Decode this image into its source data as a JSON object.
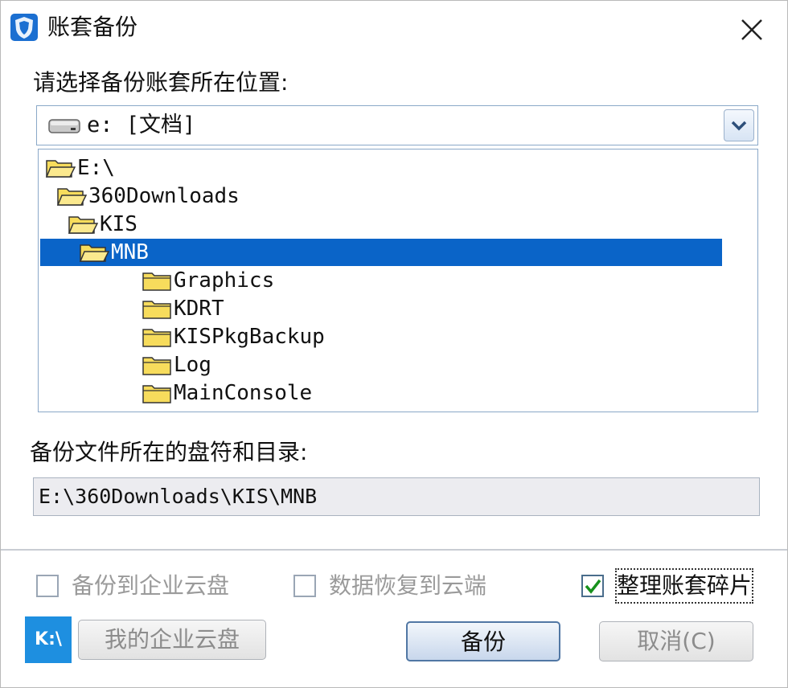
{
  "window": {
    "title": "账套备份"
  },
  "location_label": "请选择备份账套所在位置:",
  "drive_select": {
    "value": "e: [文档]"
  },
  "tree": {
    "items": [
      {
        "label": "E:\\",
        "level": 0,
        "open": true,
        "selected": false
      },
      {
        "label": "360Downloads",
        "level": 1,
        "open": true,
        "selected": false
      },
      {
        "label": "KIS",
        "level": 2,
        "open": true,
        "selected": false
      },
      {
        "label": "MNB",
        "level": 3,
        "open": true,
        "selected": true
      },
      {
        "label": "Graphics",
        "level": 4,
        "open": false,
        "selected": false
      },
      {
        "label": "KDRT",
        "level": 4,
        "open": false,
        "selected": false
      },
      {
        "label": "KISPkgBackup",
        "level": 4,
        "open": false,
        "selected": false
      },
      {
        "label": "Log",
        "level": 4,
        "open": false,
        "selected": false
      },
      {
        "label": "MainConsole",
        "level": 4,
        "open": false,
        "selected": false
      }
    ]
  },
  "target_label": "备份文件所在的盘符和目录:",
  "target_path": "E:\\360Downloads\\KIS\\MNB",
  "options": {
    "cloud_backup": {
      "label": "备份到企业云盘",
      "checked": false
    },
    "cloud_restore": {
      "label": "数据恢复到云端",
      "checked": false
    },
    "defrag": {
      "label": "整理账套碎片",
      "checked": true
    }
  },
  "buttons": {
    "my_cloud": "我的企业云盘",
    "backup": "备份",
    "cancel": "取消(C)"
  },
  "logo_text": "K:\\",
  "colors": {
    "selection": "#0a64c8",
    "logo": "#1e8fe0",
    "folder": "#f7dc5c"
  }
}
